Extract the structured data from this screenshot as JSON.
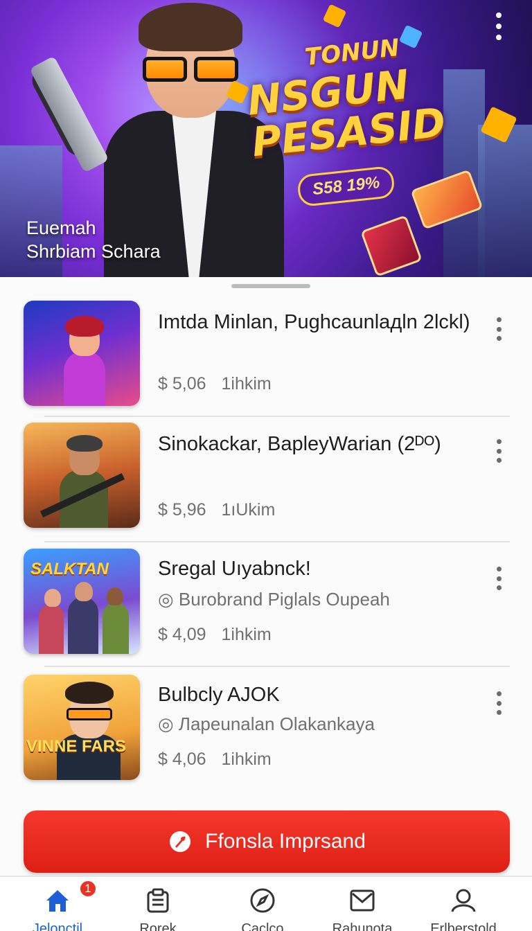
{
  "hero": {
    "title_small": "TONUN",
    "title_big": "NSGUN PESASID",
    "price_tag": "S58 19%",
    "caption_line1": "Euemah",
    "caption_line2": "Shrbiam Schara"
  },
  "list": {
    "items": [
      {
        "title": "Imtda Minlan, Pughcaunlaдln 2lckl)",
        "subtitle": "",
        "price": "$ 5,06",
        "stat": "1ihkim",
        "thumb_icon": "game-art-woman-icon"
      },
      {
        "title": "Sinokackar, BapleyWarian (2ᴰᴼ)",
        "subtitle": "",
        "price": "$ 5,96",
        "stat": "1ıUkim",
        "thumb_icon": "game-art-soldier-icon"
      },
      {
        "title": "Sregal Uıyabnck!",
        "subtitle": "◎ Burobrand Piglals Oupeah",
        "price": "$ 4,09",
        "stat": "1ihkim",
        "thumb_icon": "game-art-squad-icon",
        "thumb_logo": "SALKTAN"
      },
      {
        "title": "Bulbcly AJOK",
        "subtitle": "◎ Лapeunalan Olakankaya",
        "price": "$ 4,06",
        "stat": "1ihkim",
        "thumb_icon": "game-art-agent-icon",
        "thumb_logo": "VINNE FARS"
      }
    ]
  },
  "cta": {
    "label": "Ffonsla Imprsand",
    "icon": "rocket-icon"
  },
  "nav": {
    "items": [
      {
        "label": "Jelonctil",
        "icon": "home-icon",
        "active": true,
        "badge": "1"
      },
      {
        "label": "Rorek",
        "icon": "clipboard-icon",
        "active": false
      },
      {
        "label": "Caclco",
        "icon": "compass-icon",
        "active": false
      },
      {
        "label": "Rahunota",
        "icon": "mail-icon",
        "active": false
      },
      {
        "label": "Erlberstold",
        "icon": "profile-icon",
        "active": false
      }
    ]
  },
  "colors": {
    "accent": "#1d5fd6",
    "cta": "#ee2c22",
    "badge": "#e53424",
    "hero_title": "#ffd23e"
  }
}
